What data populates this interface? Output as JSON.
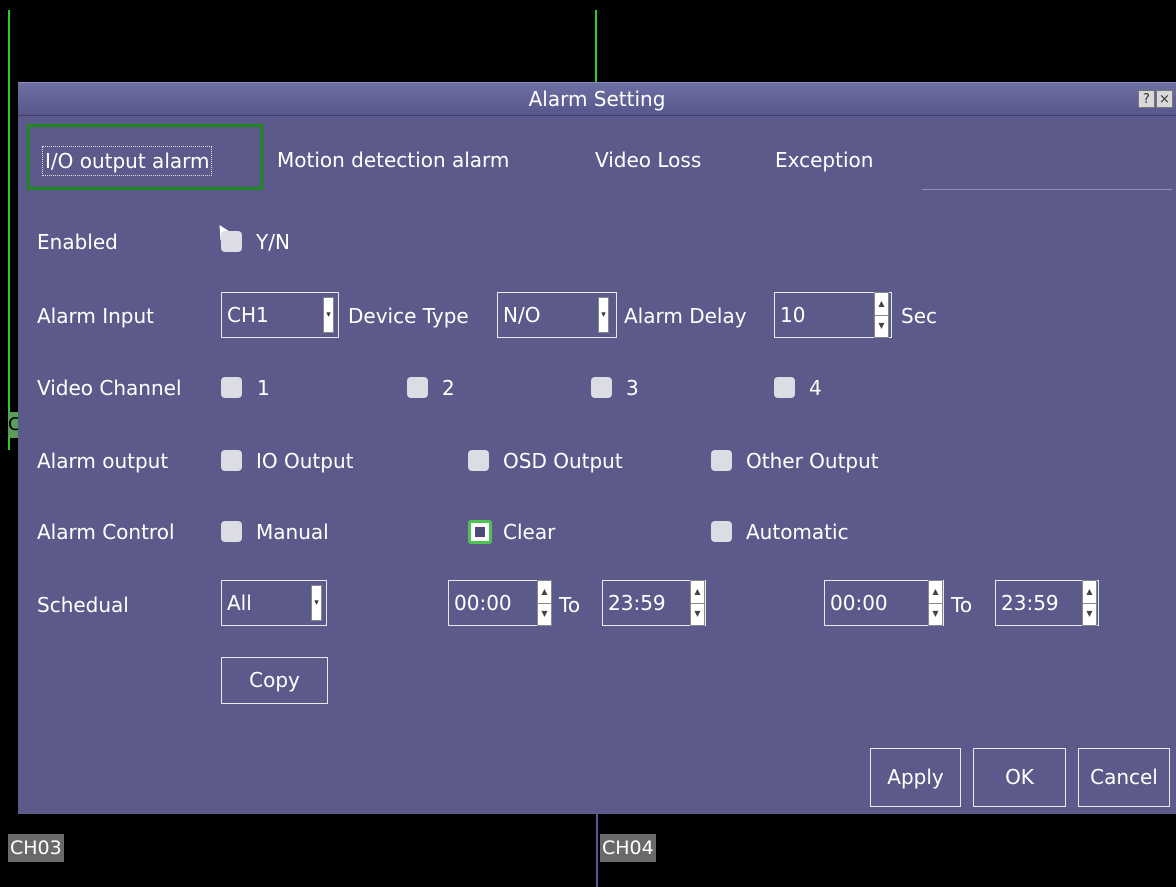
{
  "dialog": {
    "title": "Alarm Setting",
    "help_label": "?",
    "close_label": "×"
  },
  "tabs": [
    {
      "label": "I/O output alarm",
      "active": true
    },
    {
      "label": "Motion detection alarm"
    },
    {
      "label": "Video Loss"
    },
    {
      "label": "Exception"
    }
  ],
  "form": {
    "enabled_label": "Enabled",
    "enabled_option": "Y/N",
    "alarm_input_label": "Alarm Input",
    "alarm_input_value": "CH1",
    "device_type_label": "Device Type",
    "device_type_value": "N/O",
    "alarm_delay_label": "Alarm Delay",
    "alarm_delay_value": "10",
    "alarm_delay_unit": "Sec",
    "video_channel_label": "Video Channel",
    "video_channels": [
      "1",
      "2",
      "3",
      "4"
    ],
    "alarm_output_label": "Alarm output",
    "alarm_outputs": [
      "IO Output",
      "OSD Output",
      "Other Output"
    ],
    "alarm_control_label": "Alarm Control",
    "alarm_controls": [
      {
        "label": "Manual",
        "checked": false
      },
      {
        "label": "Clear",
        "checked": true
      },
      {
        "label": "Automatic",
        "checked": false
      }
    ],
    "schedule_label": "Schedual",
    "schedule_value": "All",
    "schedule_range1": {
      "from": "00:00",
      "to_label": "To",
      "to": "23:59"
    },
    "schedule_range2": {
      "from": "00:00",
      "to_label": "To",
      "to": "23:59"
    },
    "copy_label": "Copy"
  },
  "footer": {
    "apply_label": "Apply",
    "ok_label": "OK",
    "cancel_label": "Cancel"
  },
  "background": {
    "ch03_label": "CH03",
    "ch04_label": "CH04",
    "left_fragment": "C"
  },
  "colors": {
    "dialog_bg": "#5b5a8a",
    "active_tab_border": "#1e8a1e",
    "checked_border": "#4fc34f",
    "grid_line": "#2ecc2e"
  }
}
